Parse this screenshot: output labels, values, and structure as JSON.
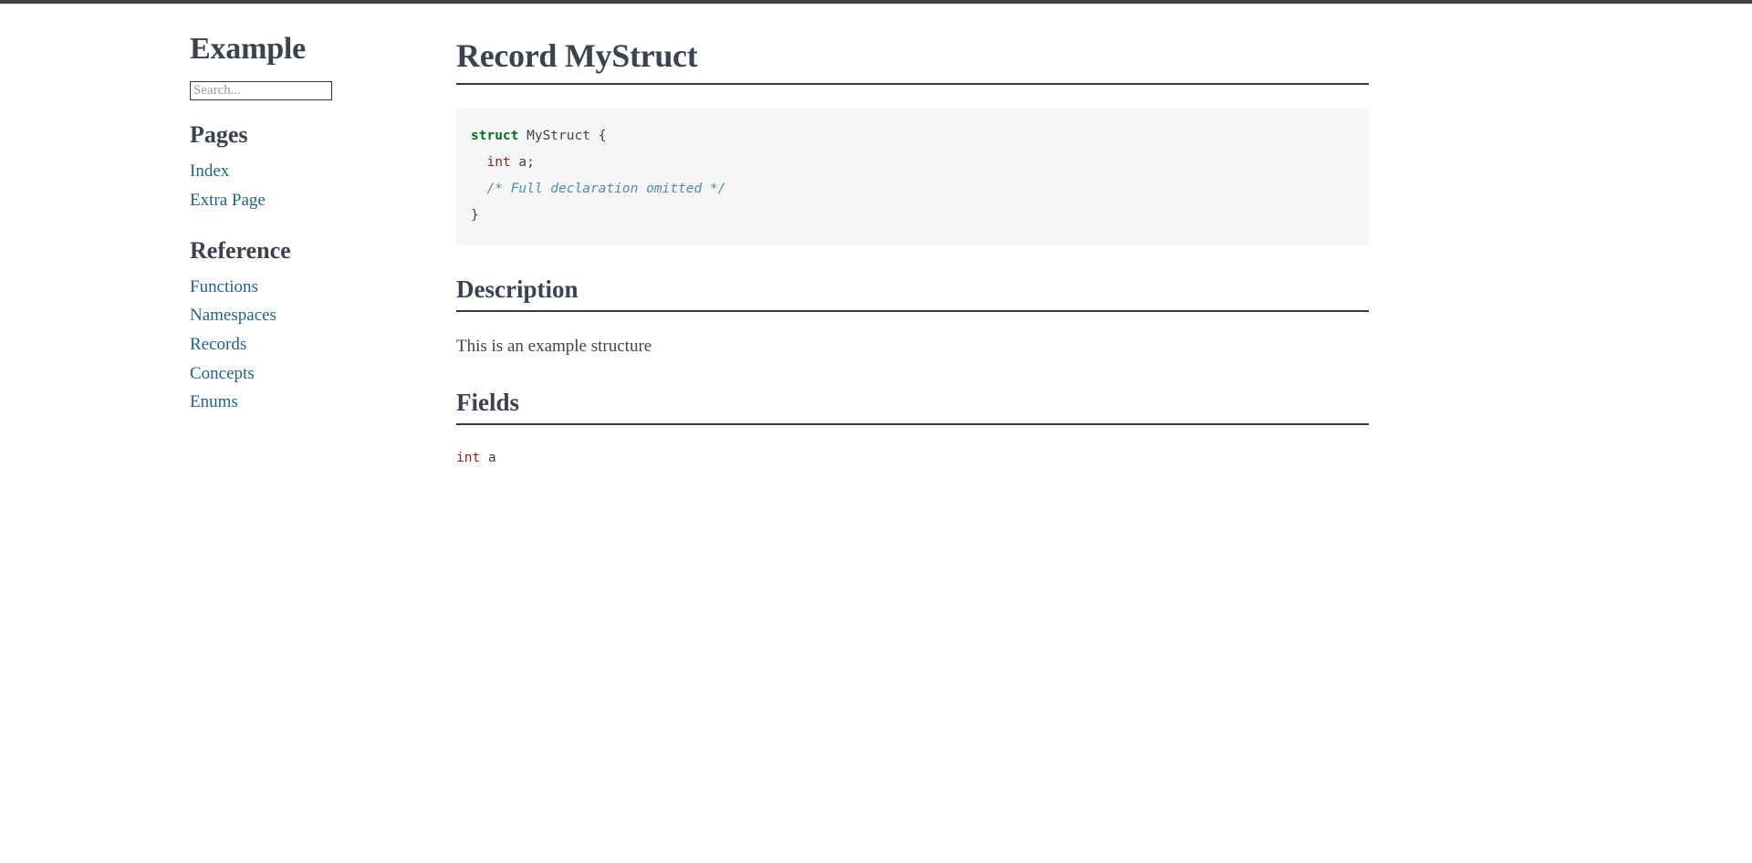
{
  "sidebar": {
    "site_title": "Example",
    "search": {
      "placeholder": "Search...",
      "value": ""
    },
    "groups": [
      {
        "heading": "Pages",
        "items": [
          {
            "label": "Index"
          },
          {
            "label": "Extra Page"
          }
        ]
      },
      {
        "heading": "Reference",
        "items": [
          {
            "label": "Functions"
          },
          {
            "label": "Namespaces"
          },
          {
            "label": "Records"
          },
          {
            "label": "Concepts"
          },
          {
            "label": "Enums"
          }
        ]
      }
    ]
  },
  "main": {
    "title": "Record MyStruct",
    "declaration": {
      "lines": [
        [
          {
            "text": "struct",
            "type": "keyword"
          },
          {
            "text": " MyStruct {",
            "type": "plain"
          }
        ],
        [
          {
            "text": "  ",
            "type": "plain"
          },
          {
            "text": "int",
            "type": "type"
          },
          {
            "text": " a;",
            "type": "plain"
          }
        ],
        [
          {
            "text": "  ",
            "type": "plain"
          },
          {
            "text": "/* Full declaration omitted */",
            "type": "comment"
          }
        ],
        [
          {
            "text": "}",
            "type": "plain"
          }
        ]
      ]
    },
    "sections": [
      {
        "heading": "Description",
        "paragraph": "This is an example structure"
      },
      {
        "heading": "Fields",
        "fields": [
          [
            {
              "text": "int",
              "type": "type"
            },
            {
              "text": " a",
              "type": "plain"
            }
          ]
        ]
      }
    ]
  },
  "colors": {
    "link": "#1f6392",
    "text": "#3b4351",
    "rule": "#34383b",
    "code_background": "#f6f6f6",
    "keyword": "#007020",
    "type": "#902020",
    "comment": "#4b8fa0"
  }
}
